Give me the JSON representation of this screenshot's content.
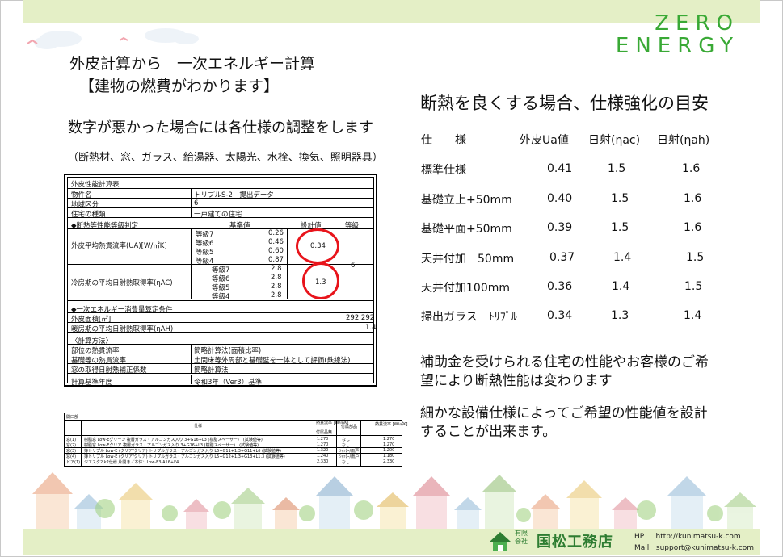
{
  "brand": {
    "line1": "ZERO",
    "line2": "ENERGY",
    "accent": "#39a935"
  },
  "left": {
    "title1": "外皮計算から　一次エネルギー計算",
    "title2": "【建物の燃費がわかります】",
    "subhead": "数字が悪かった場合には各仕様の調整をします",
    "items": "（断熱材、窓、ガラス、給湯器、太陽光、水栓、換気、照明器具）"
  },
  "calc": {
    "title": "外皮性能計算表",
    "rows_info": [
      {
        "label": "物件名",
        "value": "トリプルS-2　提出データ"
      },
      {
        "label": "地域区分",
        "value": "6"
      },
      {
        "label": "住宅の種類",
        "value": "一戸建ての住宅"
      }
    ],
    "sec1": "◆断熱等性能等級判定",
    "col_standard": "基準値",
    "col_design": "設計値",
    "col_grade": "等級",
    "ua_label": "外皮平均熱貫流率(UA)[W/㎡K]",
    "ua_grades": [
      "等級7",
      "等級6",
      "等級5",
      "等級4"
    ],
    "ua_values": [
      "0.26",
      "0.46",
      "0.60",
      "0.87"
    ],
    "ua_design": "0.34",
    "ac_label": "冷房期の平均日射熱取得率(ηAC)",
    "ac_grades": [
      "等級7",
      "等級6",
      "等級5",
      "等級4"
    ],
    "ac_values": [
      "2.8",
      "2.8",
      "2.8",
      "2.8"
    ],
    "ac_design": "1.3",
    "grade_result": "6",
    "sec2": "◆一次エネルギー消費量算定条件",
    "area_label": "外皮面積[㎡]",
    "area_value": "292.292",
    "ah_label": "暖房期の平均日射熱取得率(ηAH)",
    "ah_value": "1.4",
    "method_head": "〈計算方法〉",
    "methods": [
      {
        "label": "部位の熱貫流率",
        "value": "簡略計算法(面積比率)"
      },
      {
        "label": "基礎等の熱貫流率",
        "value": "土間床等外周部と基礎壁を一体として評価(鉄線法)"
      },
      {
        "label": "窓の取得日射熱補正係数",
        "value": "簡略計算法"
      }
    ],
    "year_label": "計算基準年度",
    "year_value": "令和3年（Ver3）基準"
  },
  "small": {
    "head": "開口部",
    "col_spec": "仕様",
    "col_u": "熱貫流率\n[W/㎡K]",
    "col_u2": "付属品無",
    "col_acc": "付属部品",
    "col_u3": "熱貫流率\n[W/㎡K]",
    "rows": [
      {
        "no": "窓(1)",
        "spec": "樹脂窓 Low-Eグリーン 複層ガラス・アルゴンガス入り 3+G16+L3 (樹脂スペーサー)　(試験値等)",
        "u": "1.270",
        "acc": "なし",
        "u2": "1.270"
      },
      {
        "no": "窓(2)",
        "spec": "樹脂窓 Low-Eクリア 複層ガラス・アルゴンガス入り 3+G16+L3 (樹脂スペーサー)　(試験値等)",
        "u": "1.270",
        "acc": "なし",
        "u2": "1.270"
      },
      {
        "no": "窓(3)",
        "spec": "簿トリプル Low-E (クリア/クリア) トリプルガラス・アルゴンガス入り L5+G11+1.3+G11+L6 (試験値等)",
        "u": "1.320",
        "acc": "ｼｬｯﾀｰ/雨戸",
        "u2": "1.200"
      },
      {
        "no": "窓(4)",
        "spec": "簿トリプル Low-E (クリア/クリア) トリプルガラス・アルゴンガス入り L5+G12+1.3+G13+L1.3 (試験値等)",
        "u": "1.240",
        "acc": "ｼｬｯﾀｰ/雨戸",
        "u2": "1.180"
      },
      {
        "no": "ドア(1)",
        "spec": "ジエスタ2 k2仕様 片開き／本体：Low-E3-A16+F4",
        "u": "2.330",
        "acc": "なし",
        "u2": "2.330"
      }
    ]
  },
  "right": {
    "heading": "断熱を良くする場合、仕様強化の目安",
    "header": {
      "spec": "仕　　様",
      "ua": "外皮Ua値",
      "nac": "日射(ηac)",
      "nah": "日射(ηah)"
    },
    "rows": [
      {
        "spec": "標準仕様",
        "ua": "0.41",
        "nac": "1.5",
        "nah": "1.6"
      },
      {
        "spec": "基礎立上+50mm",
        "ua": "0.40",
        "nac": "1.5",
        "nah": "1.6"
      },
      {
        "spec": "基礎平面+50mm",
        "ua": "0.39",
        "nac": "1.5",
        "nah": "1.6"
      },
      {
        "spec": "天井付加　50mm",
        "ua": "0.37",
        "nac": "1.4",
        "nah": "1.5"
      },
      {
        "spec": "天井付加100mm",
        "ua": "0.36",
        "nac": "1.4",
        "nah": "1.5"
      },
      {
        "spec": "掃出ガラス　ﾄﾘﾌﾟﾙ",
        "ua": "0.34",
        "nac": "1.3",
        "nah": "1.4"
      }
    ],
    "para1_l1": "補助金を受けられる住宅の性能やお客様のご希",
    "para1_l2": "望により断熱性能は変わります",
    "para2_l1": "細かな設備仕様によってご希望の性能値を設計",
    "para2_l2": "することが出来ます。"
  },
  "footer": {
    "kind1": "有限",
    "kind2": "会社",
    "company": "国松工務店",
    "hp_label": "HP",
    "hp": "http://kunimatsu-k.com",
    "mail_label": "Mail",
    "mail": "support@kunimatsu-k.com",
    "color": "#2e7d32"
  }
}
